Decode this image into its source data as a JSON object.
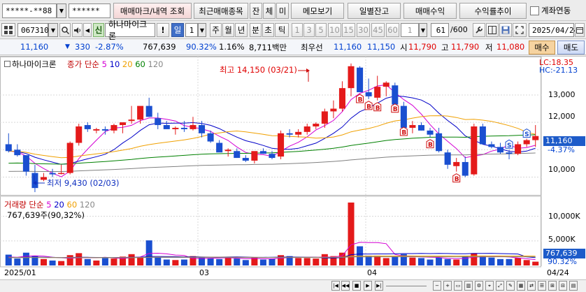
{
  "account": {
    "number": "*****-**88",
    "password": "******"
  },
  "top_buttons": {
    "trade_mark": "매매마크/내역 조회",
    "recent_items": "최근매매종목",
    "balance": "잔",
    "fill": "체",
    "unfilled": "미",
    "memo": "메모보기",
    "daily_balance": "일별잔고",
    "trade_profit": "매매수익",
    "profit_trend": "수익률추이",
    "account_link": "계좌연동"
  },
  "toolbar": {
    "stock_code": "067310",
    "new_badge": "신",
    "stock_name": "하나마이크론",
    "alert_mark": "!",
    "period_day": "일",
    "period_value": "1",
    "period_week": "주",
    "period_month": "월",
    "period_year": "년",
    "period_minute": "분",
    "period_second": "초",
    "period_tick": "틱",
    "numbers": [
      "1",
      "3",
      "5",
      "10",
      "15",
      "30",
      "45",
      "60"
    ],
    "count_value": "1",
    "display_count": "61",
    "display_total": "/600",
    "date": "2025/04/24"
  },
  "quote": {
    "price": "11,160",
    "change_arrow": "▼",
    "change": "330",
    "change_pct": "-2.87%",
    "volume": "767,639",
    "vol_ratio": "90.32%",
    "turnover": "1.16%",
    "amount": "8,711백만",
    "best_sell_label": "최우선",
    "best_ask": "11,160",
    "best_bid": "11,150",
    "open_label": "시",
    "open": "11,790",
    "high_label": "고",
    "high": "11,790",
    "low_label": "저",
    "low": "11,080",
    "buy_button": "매수",
    "sell_button": "매도"
  },
  "price_chart": {
    "stock_title": "하나마이크론",
    "indicator_label": "종가 단순",
    "ma_periods": [
      "5",
      "10",
      "20",
      "60",
      "120"
    ],
    "ma_colors": [
      "#d400d4",
      "#0000c8",
      "#f0a000",
      "#008000",
      "#808080"
    ],
    "lc": "LC:18.35",
    "hc": "HC:-21.13",
    "high_annotation": "최고 14,150 (03/21)",
    "low_annotation": "최저 9,430 (02/03)",
    "current_tag": "11,160",
    "current_pct": "-4.37%",
    "y_ticks": [
      "13,000",
      "12,000",
      "11,000",
      "10,000"
    ]
  },
  "volume_chart": {
    "title": "거래량",
    "indicator_label": "단순",
    "ma_periods": [
      "5",
      "20",
      "60",
      "120"
    ],
    "ma_colors": [
      "#d400d4",
      "#0000c8",
      "#f0a000",
      "#808080"
    ],
    "current_volume": "767,639주(90,32%)",
    "current_tag": "767,639",
    "current_pct": "90.32%",
    "y_ticks": [
      "10,000K",
      "5,000K"
    ]
  },
  "x_axis": {
    "labels": [
      "2025/01",
      "03",
      "04",
      "04/24"
    ]
  },
  "chart_data": {
    "type": "candlestick",
    "series": [
      {
        "name": "OHLC",
        "values": [
          [
            11.2,
            11.6,
            10.9,
            10.95
          ],
          [
            11.0,
            11.2,
            10.75,
            10.8
          ],
          [
            10.8,
            10.8,
            10.05,
            10.2
          ],
          [
            10.15,
            10.45,
            9.45,
            9.6
          ],
          [
            9.9,
            10.15,
            9.85,
            10.0
          ],
          [
            10.15,
            10.3,
            10.0,
            10.1
          ],
          [
            10.15,
            10.45,
            10.1,
            10.15
          ],
          [
            10.15,
            11.3,
            10.1,
            11.25
          ],
          [
            11.25,
            11.95,
            11.15,
            11.85
          ],
          [
            11.9,
            12.0,
            11.65,
            11.75
          ],
          [
            11.7,
            11.8,
            11.6,
            11.75
          ],
          [
            11.75,
            11.85,
            11.55,
            11.7
          ],
          [
            11.7,
            11.95,
            11.6,
            11.9
          ],
          [
            11.9,
            12.0,
            11.6,
            12.0
          ],
          [
            12.05,
            12.6,
            11.95,
            12.1
          ],
          [
            12.1,
            12.4,
            11.95,
            12.6
          ],
          [
            12.6,
            12.9,
            12.2,
            12.2
          ],
          [
            12.15,
            12.35,
            11.75,
            11.9
          ],
          [
            11.9,
            12.05,
            11.8,
            11.75
          ],
          [
            11.75,
            11.85,
            11.55,
            11.8
          ],
          [
            11.8,
            12.05,
            11.65,
            11.75
          ],
          [
            11.75,
            12.2,
            11.7,
            11.9
          ],
          [
            11.9,
            12.05,
            11.45,
            11.6
          ],
          [
            11.6,
            11.7,
            11.25,
            11.3
          ],
          [
            11.25,
            11.35,
            10.95,
            10.9
          ],
          [
            10.95,
            11.05,
            10.75,
            11.0
          ],
          [
            10.95,
            11.05,
            10.7,
            10.7
          ],
          [
            10.7,
            10.8,
            10.55,
            10.6
          ],
          [
            10.6,
            10.75,
            10.5,
            10.95
          ],
          [
            10.95,
            11.05,
            10.85,
            10.85
          ],
          [
            10.85,
            10.95,
            10.65,
            10.7
          ],
          [
            10.75,
            11.7,
            10.65,
            11.6
          ],
          [
            11.6,
            11.75,
            11.45,
            11.55
          ],
          [
            11.55,
            11.75,
            11.45,
            11.65
          ],
          [
            11.65,
            11.95,
            11.55,
            11.85
          ],
          [
            11.85,
            12.0,
            11.75,
            11.95
          ],
          [
            11.95,
            12.5,
            11.8,
            12.4
          ],
          [
            12.4,
            12.8,
            12.15,
            12.5
          ],
          [
            12.5,
            13.5,
            12.4,
            13.25
          ],
          [
            13.25,
            14.15,
            12.95,
            14.05
          ],
          [
            14.0,
            14.05,
            13.1,
            13.1
          ],
          [
            13.1,
            13.6,
            12.85,
            12.95
          ],
          [
            12.9,
            13.7,
            12.8,
            13.3
          ],
          [
            13.3,
            13.5,
            12.95,
            13.45
          ],
          [
            13.35,
            13.45,
            12.75,
            12.65
          ],
          [
            12.6,
            12.75,
            11.9,
            11.8
          ],
          [
            11.8,
            12.05,
            11.6,
            11.9
          ],
          [
            11.9,
            12.0,
            11.7,
            11.7
          ],
          [
            11.7,
            11.8,
            11.45,
            11.55
          ],
          [
            11.6,
            11.8,
            10.9,
            10.95
          ],
          [
            10.9,
            11.0,
            10.3,
            10.45
          ],
          [
            10.4,
            10.7,
            10.2,
            10.55
          ],
          [
            10.55,
            10.75,
            10.0,
            10.05
          ],
          [
            10.1,
            11.95,
            10.05,
            11.85
          ],
          [
            11.85,
            11.95,
            11.25,
            11.2
          ],
          [
            11.2,
            11.3,
            11.05,
            11.1
          ],
          [
            11.1,
            11.25,
            10.85,
            10.9
          ],
          [
            10.9,
            11.0,
            10.65,
            10.85
          ],
          [
            10.85,
            11.3,
            10.8,
            11.2
          ],
          [
            11.2,
            11.4,
            11.1,
            11.35
          ],
          [
            11.35,
            11.9,
            11.1,
            11.5
          ]
        ]
      }
    ],
    "volume_values": [
      2.2,
      1.4,
      2.6,
      2.0,
      1.3,
      1.0,
      0.9,
      2.1,
      2.5,
      1.3,
      1.0,
      1.5,
      1.4,
      1.8,
      2.3,
      1.6,
      5.1,
      1.6,
      1.2,
      1.1,
      1.2,
      1.9,
      1.6,
      1.5,
      1.3,
      1.6,
      1.4,
      1.1,
      1.6,
      1.2,
      1.4,
      2.1,
      1.9,
      1.5,
      1.5,
      1.4,
      2.3,
      1.9,
      2.6,
      12.8,
      3.9,
      2.0,
      2.0,
      1.5,
      1.8,
      2.3,
      1.6,
      1.5,
      1.2,
      1.6,
      1.3,
      1.2,
      1.9,
      2.5,
      1.9,
      1.6,
      1.3,
      1.3,
      1.5,
      1.1,
      0.77
    ],
    "ylim": [
      9.4,
      14.3
    ],
    "volume_ylim": [
      0,
      13.5
    ],
    "unit_price": "thousand KRW",
    "unit_volume": "million shares"
  }
}
